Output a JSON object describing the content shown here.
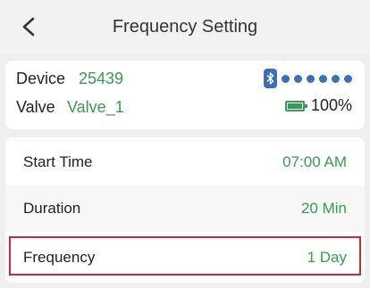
{
  "colors": {
    "accent_green": "#3a9a55",
    "bluetooth_blue": "#3b6fb6",
    "highlight_red": "#c62a3b"
  },
  "header": {
    "back_icon": "chevron-left-icon",
    "title": "Frequency Setting"
  },
  "device_card": {
    "device_label": "Device",
    "device_value": "25439",
    "valve_label": "Valve",
    "valve_value": "Valve_1",
    "bluetooth_icon": "bluetooth-icon",
    "signal_dots": 6,
    "battery_icon": "battery-icon",
    "battery_level_percent": 100,
    "battery_text": "100%"
  },
  "settings": [
    {
      "label": "Start Time",
      "value": "07:00 AM"
    },
    {
      "label": "Duration",
      "value": "20 Min"
    },
    {
      "label": "Frequency",
      "value": "1 Day",
      "highlighted": true
    }
  ]
}
